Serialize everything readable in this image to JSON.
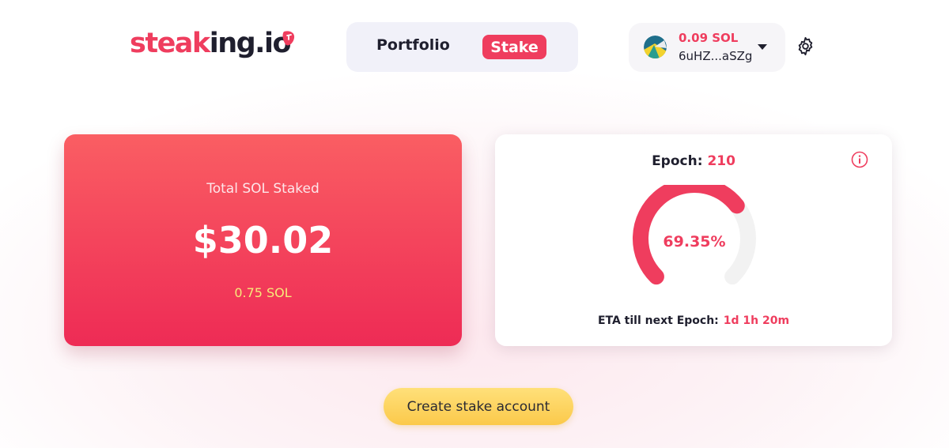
{
  "logo": {
    "part1": "steak",
    "part2": "ing.io"
  },
  "nav": {
    "portfolio_label": "Portfolio",
    "stake_label": "Stake"
  },
  "wallet": {
    "balance": "0.09 SOL",
    "address": "6uHZ...aSZg"
  },
  "total": {
    "label": "Total SOL Staked",
    "value": "$30.02",
    "sol": "0.75 SOL"
  },
  "epoch": {
    "label": "Epoch:",
    "number": "210",
    "progress_pct": 69.35,
    "progress_text": "69.35%",
    "eta_label": "ETA till next Epoch:",
    "eta_value": "1d 1h 20m"
  },
  "cta": {
    "label": "Create stake account"
  },
  "colors": {
    "accent": "#ef3d5e",
    "sol_yellow": "#f7e97a",
    "cta_yellow": "#fbc94a",
    "track": "#f2f2f2"
  }
}
